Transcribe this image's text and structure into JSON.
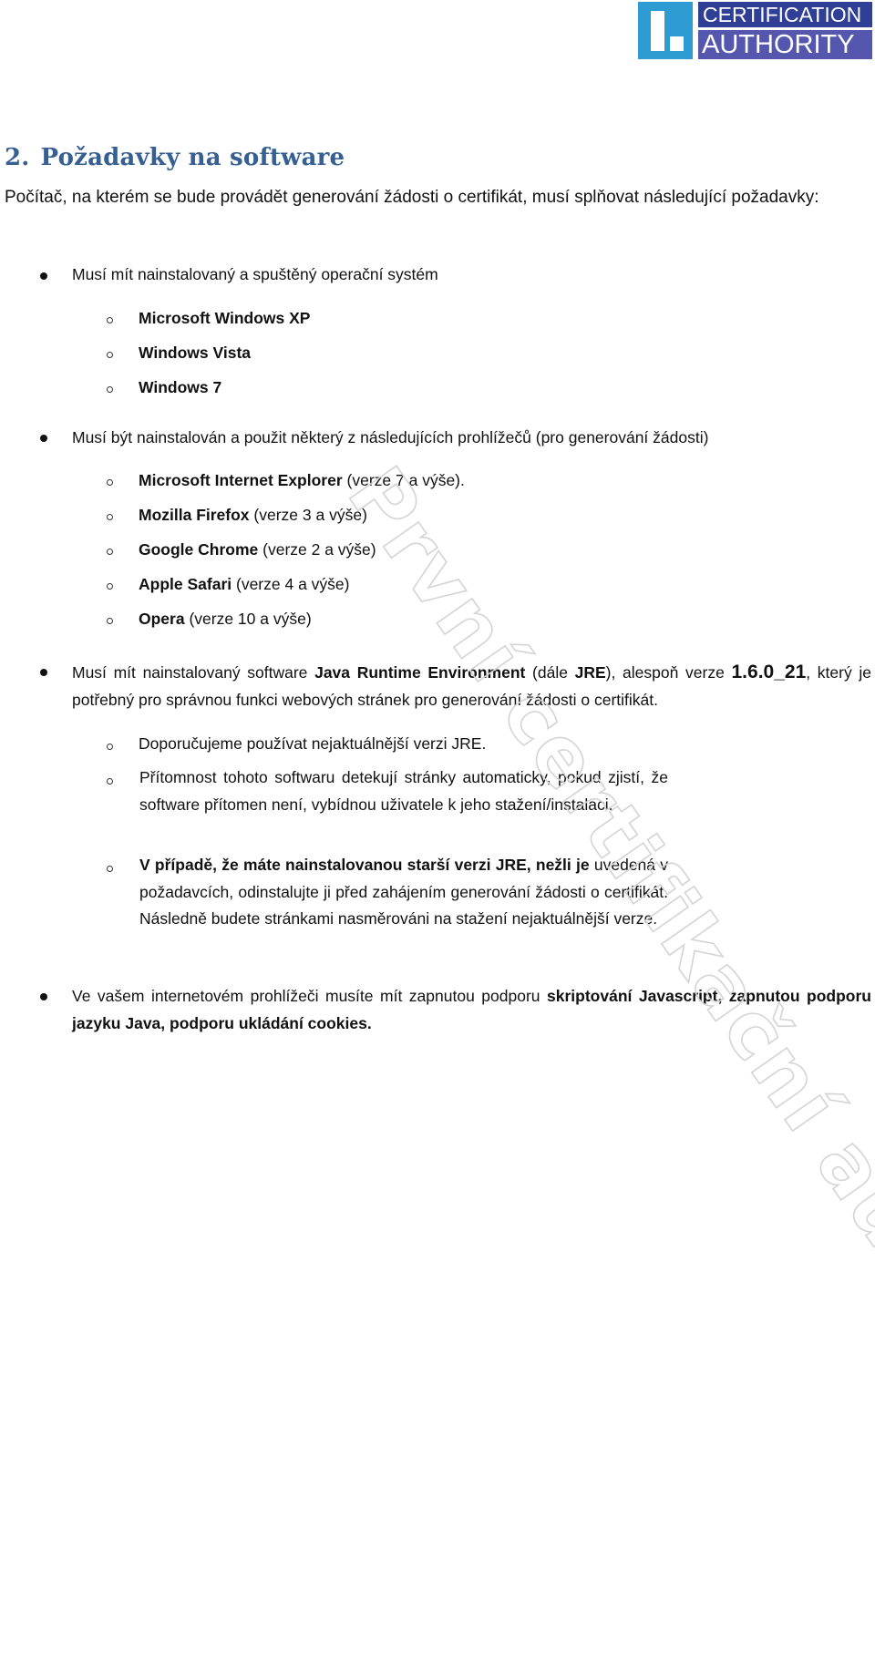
{
  "logo": {
    "line1": "CERTIFICATION",
    "line2": "AUTHORITY",
    "colors": {
      "mark": "#2f9bd3",
      "line1_bg": "#2e3f95",
      "line2_bg": "#5457ad"
    }
  },
  "heading": {
    "number": "2.",
    "title": "Požadavky na software",
    "color": "#376092"
  },
  "intro": "Počítač, na kterém se bude provádět generování žádosti o certifikát, musí splňovat následující požadavky:",
  "requirements": [
    {
      "text": "Musí mít nainstalovaný a spuštěný operační systém",
      "items": [
        {
          "bold": "Microsoft Windows XP",
          "rest": ""
        },
        {
          "bold": "Windows Vista",
          "rest": ""
        },
        {
          "bold": "Windows 7",
          "rest": ""
        }
      ]
    },
    {
      "text": "Musí být nainstalován a použit některý z následujících prohlížečů (pro generování žádosti)",
      "items": [
        {
          "bold": "Microsoft Internet Explorer",
          "rest": " (verze 7 a výše)."
        },
        {
          "bold": "Mozilla Firefox",
          "rest": " (verze 3 a výše)"
        },
        {
          "bold": "Google Chrome",
          "rest": " (verze 2 a výše)"
        },
        {
          "bold": "Apple Safari",
          "rest": " (verze 4 a výše)"
        },
        {
          "bold": "Opera",
          "rest": " (verze 10 a výše)"
        }
      ]
    },
    {
      "parts": {
        "a": "Musí mít nainstalovaný software ",
        "b_bold": "Java Runtime Environment",
        "c": " (dále ",
        "d_bold": "JRE",
        "e": "), alespoň verze ",
        "f_bold": "1.6.0_21",
        "g": ", který je potřebný pro správnou funkci webových stránek pro generování žádosti o certifikát."
      },
      "items": [
        {
          "text": "Doporučujeme používat nejaktuálnější verzi JRE."
        },
        {
          "text": "Přítomnost tohoto softwaru detekují stránky automaticky, pokud zjistí, že software přítomen není, vybídnou uživatele k jeho stažení/instalaci."
        },
        {
          "bold": "V případě, že máte nainstalovanou starší verzi JRE, nežli je",
          "rest": " uvedená v požadavcích, odinstalujte ji před zahájením generování žádosti o certifikát. Následně budete stránkami nasměrováni na stažení nejaktuálnější verze."
        }
      ]
    },
    {
      "parts": {
        "a": "Ve vašem internetovém prohlížeči musíte mít zapnutou podporu ",
        "b_bold": "skriptování Javascript, zapnutou podporu jazyku Java, podporu ukládání cookies."
      }
    }
  ],
  "watermark": "První certifikační autorita, a.s."
}
